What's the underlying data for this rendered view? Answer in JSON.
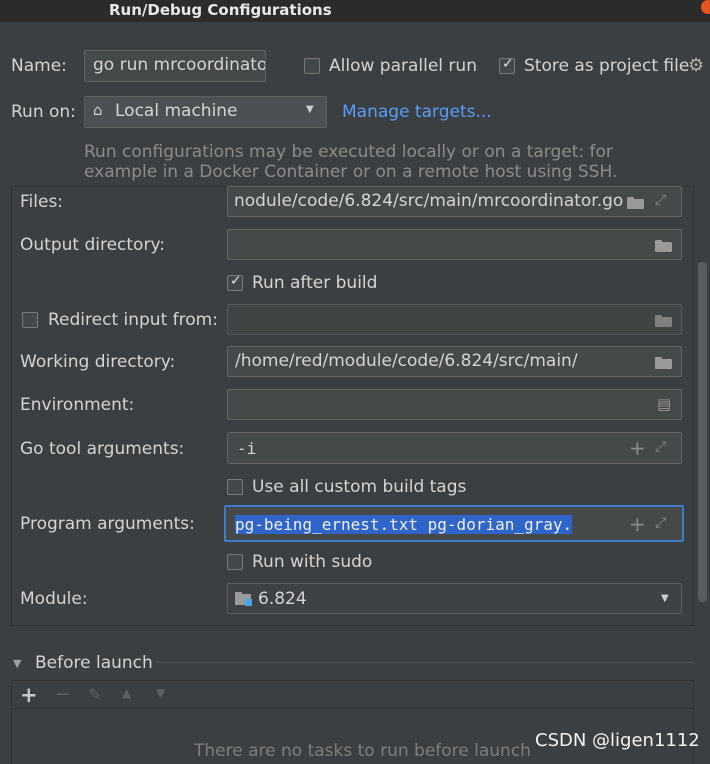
{
  "window": {
    "title": "Run/Debug Configurations"
  },
  "top": {
    "name_label": "Name:",
    "name_value": "go run mrcoordinato",
    "allow_parallel_label": "Allow parallel run",
    "allow_parallel_checked": false,
    "store_project_label": "Store as project file",
    "store_project_checked": true,
    "run_on_label": "Run on:",
    "run_on_value": "Local machine",
    "manage_targets_link": "Manage targets...",
    "hint_line1": "Run configurations may be executed locally or on a target: for",
    "hint_line2": "example in a Docker Container or on a remote host using SSH."
  },
  "form": {
    "files_label": "Files:",
    "files_value": "nodule/code/6.824/src/main/mrcoordinator.go",
    "output_dir_label": "Output directory:",
    "output_dir_value": "",
    "run_after_build_label": "Run after build",
    "run_after_build_checked": true,
    "redirect_label": "Redirect input from:",
    "redirect_checked": false,
    "redirect_value": "",
    "working_dir_label": "Working directory:",
    "working_dir_value": "/home/red/module/code/6.824/src/main/",
    "env_label": "Environment:",
    "env_value": "",
    "go_tool_args_label": "Go tool arguments:",
    "go_tool_args_value": "-i",
    "custom_tags_label": "Use all custom build tags",
    "custom_tags_checked": false,
    "program_args_label": "Program arguments:",
    "program_args_value": "pg-being_ernest.txt pg-dorian_gray.",
    "sudo_label": "Run with sudo",
    "sudo_checked": false,
    "module_label": "Module:",
    "module_value": "6.824"
  },
  "before_launch": {
    "title": "Before launch",
    "empty_text": "There are no tasks to run before launch"
  },
  "watermark": "CSDN @ligen1112",
  "colors": {
    "accent": "#589df6",
    "selection": "#2f65ca",
    "background": "#3c3f41"
  }
}
